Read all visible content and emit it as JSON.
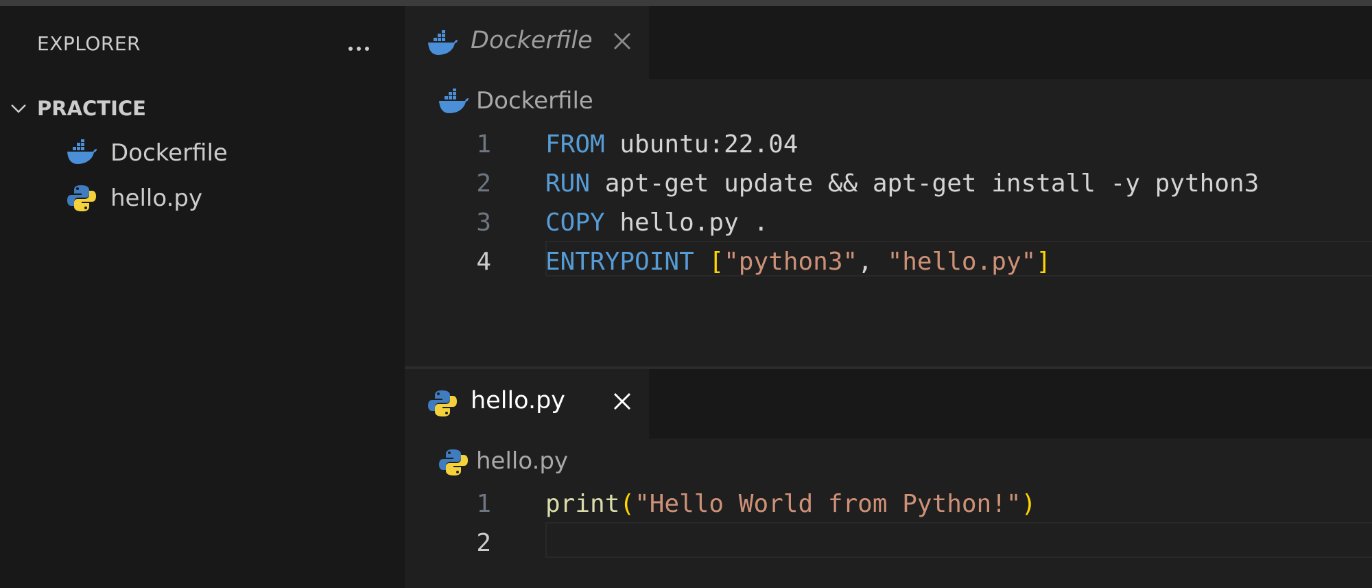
{
  "explorer": {
    "title": "EXPLORER",
    "folder": "PRACTICE",
    "files": [
      {
        "label": "Dockerfile",
        "icon": "docker-icon"
      },
      {
        "label": "hello.py",
        "icon": "python-icon"
      }
    ]
  },
  "editors": {
    "top": {
      "tab_label": "Dockerfile",
      "tab_preview": true,
      "breadcrumb": "Dockerfile",
      "lines": [
        {
          "number": "1",
          "keyword": "FROM",
          "rest": " ubuntu:22.04"
        },
        {
          "number": "2",
          "keyword": "RUN",
          "rest": " apt-get update && apt-get install -y python3"
        },
        {
          "number": "3",
          "keyword": "COPY",
          "rest": " hello.py ."
        },
        {
          "number": "4",
          "keyword": "ENTRYPOINT",
          "space": " ",
          "open": "[",
          "s1": "\"python3\"",
          "comma": ", ",
          "s2": "\"hello.py\"",
          "close": "]"
        }
      ]
    },
    "bottom": {
      "tab_label": "hello.py",
      "breadcrumb": "hello.py",
      "lines": [
        {
          "number": "1",
          "func": "print",
          "open": "(",
          "str": "\"Hello World from Python!\"",
          "close": ")"
        },
        {
          "number": "2"
        }
      ]
    }
  },
  "colors": {
    "keyword": "#569cd6",
    "string": "#ce9178",
    "bracket": "#ffd700",
    "function": "#dcdcaa",
    "docker": "#4a8fd8",
    "python_blue": "#3f7cc0",
    "python_yellow": "#f5d23b"
  }
}
